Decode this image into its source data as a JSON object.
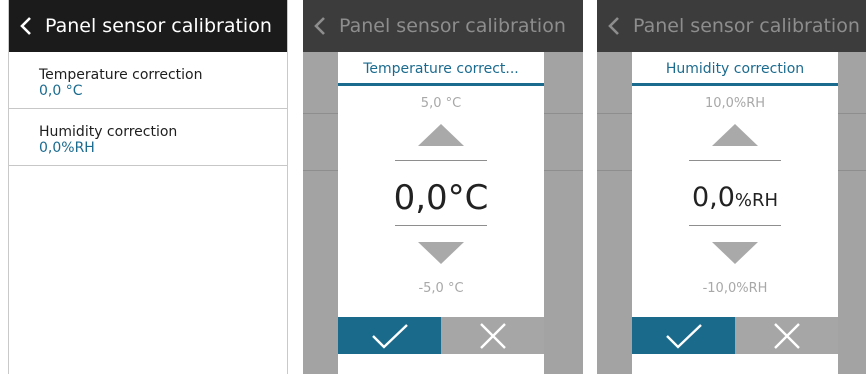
{
  "screen1": {
    "header_title": "Panel sensor calibration",
    "items": [
      {
        "label": "Temperature correction",
        "value": "0,0 °C"
      },
      {
        "label": "Humidity correction",
        "value": "0,0%RH"
      }
    ]
  },
  "screen2": {
    "header_title": "Panel sensor calibration",
    "dialog": {
      "title": "Temperature correct...",
      "max": "5,0 °C",
      "value": "0,0°C",
      "min": "-5,0 °C"
    }
  },
  "screen3": {
    "header_title": "Panel sensor calibration",
    "dialog": {
      "title": "Humidity correction",
      "max": "10,0%RH",
      "value_number": "0,0",
      "value_unit": "%RH",
      "min": "-10,0%RH"
    }
  },
  "icons": {
    "back": "chevron-left-icon",
    "up": "triangle-up-icon",
    "down": "triangle-down-icon",
    "confirm": "checkmark-icon",
    "cancel": "close-icon"
  },
  "colors": {
    "header": "#1b1b1b",
    "accent": "#1b6b8f",
    "confirm_button": "#1a6a8c",
    "cancel_button": "#a6a6a6",
    "overlay": "#a3a3a3"
  }
}
